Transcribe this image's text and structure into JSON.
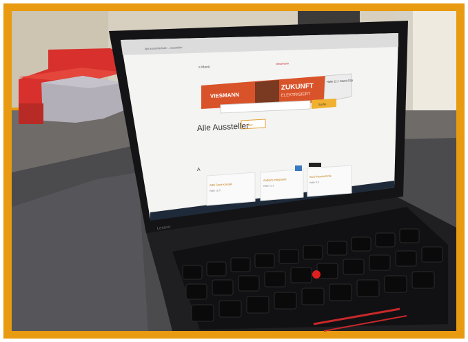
{
  "photo": {
    "border_color": "#e89a10",
    "subject": "laptop-on-table",
    "colors": {
      "wall": "#d9d2c4",
      "sofa_red": "#d8302c",
      "cushion_grey": "#b0acb6",
      "table": "#4a4a4c",
      "laptop_body": "#1b1b1d"
    }
  },
  "laptop": {
    "brand_bezel": "Lenovo",
    "browser": {
      "address": "fgw.ausstellerliste/…/aussteller",
      "nav_menu": "≡ Menü"
    },
    "site_logo": "viessmann",
    "banner": {
      "brand": "VIESMANN",
      "headline": "ZUKUNFT",
      "subline": "ELEKTRISIERT",
      "side_note": "Halle 12.1 Stand C58",
      "bg_color": "#d9532a"
    },
    "page": {
      "search_button": "Suche",
      "heading": "Alle Aussteller",
      "filter_button": "Filter",
      "section_letter": "A",
      "exhibitors": [
        {
          "name": "ABB Stotz-Kontakt",
          "hall": "Halle 12.0"
        },
        {
          "name": "Aalberts integrated",
          "hall": "Halle 11.1"
        },
        {
          "name": "ACO Haustechnik",
          "hall": "Halle 9.0"
        }
      ]
    }
  }
}
